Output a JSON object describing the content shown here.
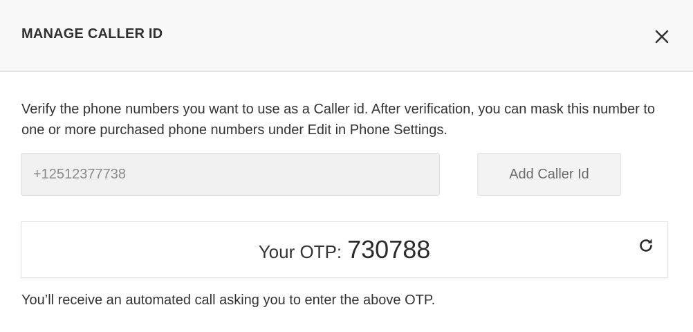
{
  "dialog": {
    "title": "MANAGE CALLER ID",
    "close_icon": "close-icon"
  },
  "description": "Verify the phone numbers you want to use as a Caller id. After verification, you can mask this number to one or more purchased phone numbers under Edit in Phone Settings.",
  "phone_field": {
    "value": "+12512377738",
    "placeholder": ""
  },
  "add_button": {
    "label": "Add Caller Id"
  },
  "otp": {
    "label": "Your OTP:",
    "value": "730788",
    "refresh_icon": "refresh-icon"
  },
  "footer_note": "You’ll receive an automated call asking you to enter the above OTP.",
  "colors": {
    "header_bg": "#f8f8f8",
    "input_bg": "#f0f0f0",
    "button_bg": "#f3f3f3",
    "text": "#333333",
    "muted_text": "#8a8a8a"
  }
}
